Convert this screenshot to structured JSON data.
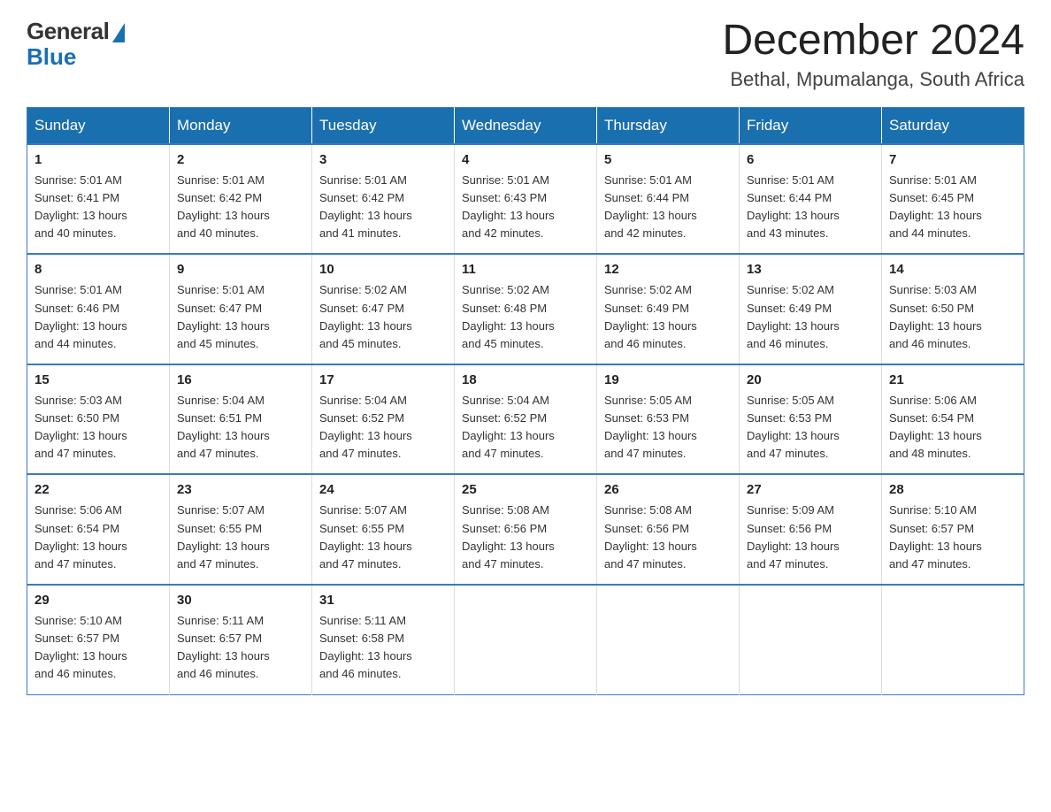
{
  "logo": {
    "general": "General",
    "blue": "Blue"
  },
  "title": {
    "month": "December 2024",
    "location": "Bethal, Mpumalanga, South Africa"
  },
  "weekdays": [
    "Sunday",
    "Monday",
    "Tuesday",
    "Wednesday",
    "Thursday",
    "Friday",
    "Saturday"
  ],
  "weeks": [
    [
      {
        "day": "1",
        "sunrise": "5:01 AM",
        "sunset": "6:41 PM",
        "daylight": "13 hours and 40 minutes."
      },
      {
        "day": "2",
        "sunrise": "5:01 AM",
        "sunset": "6:42 PM",
        "daylight": "13 hours and 40 minutes."
      },
      {
        "day": "3",
        "sunrise": "5:01 AM",
        "sunset": "6:42 PM",
        "daylight": "13 hours and 41 minutes."
      },
      {
        "day": "4",
        "sunrise": "5:01 AM",
        "sunset": "6:43 PM",
        "daylight": "13 hours and 42 minutes."
      },
      {
        "day": "5",
        "sunrise": "5:01 AM",
        "sunset": "6:44 PM",
        "daylight": "13 hours and 42 minutes."
      },
      {
        "day": "6",
        "sunrise": "5:01 AM",
        "sunset": "6:44 PM",
        "daylight": "13 hours and 43 minutes."
      },
      {
        "day": "7",
        "sunrise": "5:01 AM",
        "sunset": "6:45 PM",
        "daylight": "13 hours and 44 minutes."
      }
    ],
    [
      {
        "day": "8",
        "sunrise": "5:01 AM",
        "sunset": "6:46 PM",
        "daylight": "13 hours and 44 minutes."
      },
      {
        "day": "9",
        "sunrise": "5:01 AM",
        "sunset": "6:47 PM",
        "daylight": "13 hours and 45 minutes."
      },
      {
        "day": "10",
        "sunrise": "5:02 AM",
        "sunset": "6:47 PM",
        "daylight": "13 hours and 45 minutes."
      },
      {
        "day": "11",
        "sunrise": "5:02 AM",
        "sunset": "6:48 PM",
        "daylight": "13 hours and 45 minutes."
      },
      {
        "day": "12",
        "sunrise": "5:02 AM",
        "sunset": "6:49 PM",
        "daylight": "13 hours and 46 minutes."
      },
      {
        "day": "13",
        "sunrise": "5:02 AM",
        "sunset": "6:49 PM",
        "daylight": "13 hours and 46 minutes."
      },
      {
        "day": "14",
        "sunrise": "5:03 AM",
        "sunset": "6:50 PM",
        "daylight": "13 hours and 46 minutes."
      }
    ],
    [
      {
        "day": "15",
        "sunrise": "5:03 AM",
        "sunset": "6:50 PM",
        "daylight": "13 hours and 47 minutes."
      },
      {
        "day": "16",
        "sunrise": "5:04 AM",
        "sunset": "6:51 PM",
        "daylight": "13 hours and 47 minutes."
      },
      {
        "day": "17",
        "sunrise": "5:04 AM",
        "sunset": "6:52 PM",
        "daylight": "13 hours and 47 minutes."
      },
      {
        "day": "18",
        "sunrise": "5:04 AM",
        "sunset": "6:52 PM",
        "daylight": "13 hours and 47 minutes."
      },
      {
        "day": "19",
        "sunrise": "5:05 AM",
        "sunset": "6:53 PM",
        "daylight": "13 hours and 47 minutes."
      },
      {
        "day": "20",
        "sunrise": "5:05 AM",
        "sunset": "6:53 PM",
        "daylight": "13 hours and 47 minutes."
      },
      {
        "day": "21",
        "sunrise": "5:06 AM",
        "sunset": "6:54 PM",
        "daylight": "13 hours and 48 minutes."
      }
    ],
    [
      {
        "day": "22",
        "sunrise": "5:06 AM",
        "sunset": "6:54 PM",
        "daylight": "13 hours and 47 minutes."
      },
      {
        "day": "23",
        "sunrise": "5:07 AM",
        "sunset": "6:55 PM",
        "daylight": "13 hours and 47 minutes."
      },
      {
        "day": "24",
        "sunrise": "5:07 AM",
        "sunset": "6:55 PM",
        "daylight": "13 hours and 47 minutes."
      },
      {
        "day": "25",
        "sunrise": "5:08 AM",
        "sunset": "6:56 PM",
        "daylight": "13 hours and 47 minutes."
      },
      {
        "day": "26",
        "sunrise": "5:08 AM",
        "sunset": "6:56 PM",
        "daylight": "13 hours and 47 minutes."
      },
      {
        "day": "27",
        "sunrise": "5:09 AM",
        "sunset": "6:56 PM",
        "daylight": "13 hours and 47 minutes."
      },
      {
        "day": "28",
        "sunrise": "5:10 AM",
        "sunset": "6:57 PM",
        "daylight": "13 hours and 47 minutes."
      }
    ],
    [
      {
        "day": "29",
        "sunrise": "5:10 AM",
        "sunset": "6:57 PM",
        "daylight": "13 hours and 46 minutes."
      },
      {
        "day": "30",
        "sunrise": "5:11 AM",
        "sunset": "6:57 PM",
        "daylight": "13 hours and 46 minutes."
      },
      {
        "day": "31",
        "sunrise": "5:11 AM",
        "sunset": "6:58 PM",
        "daylight": "13 hours and 46 minutes."
      },
      null,
      null,
      null,
      null
    ]
  ],
  "labels": {
    "sunrise": "Sunrise:",
    "sunset": "Sunset:",
    "daylight": "Daylight:"
  }
}
